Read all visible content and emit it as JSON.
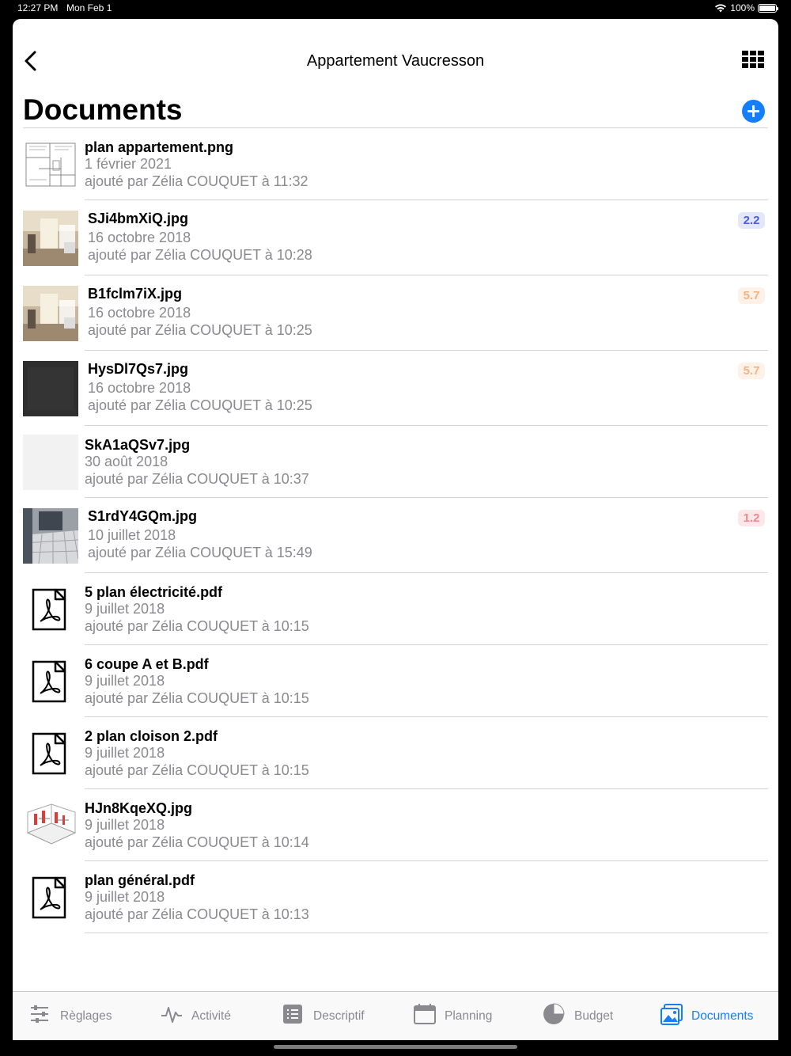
{
  "status": {
    "time": "12:27 PM",
    "date": "Mon Feb 1",
    "battery": "100%"
  },
  "nav": {
    "title": "Appartement Vaucresson"
  },
  "page": {
    "title": "Documents"
  },
  "colors": {
    "accent": "#147efb",
    "badge_blue": "#4a5fe0",
    "badge_orange": "#f2b385",
    "badge_red": "#f4868e"
  },
  "documents": [
    {
      "name": "plan appartement.png",
      "date": "1 février 2021",
      "added_by": "ajouté par Zélia COUQUET à 11:32",
      "thumb": "floorplan"
    },
    {
      "name": "SJi4bmXiQ.jpg",
      "date": "16 octobre 2018",
      "added_by": "ajouté par Zélia COUQUET à 10:28",
      "thumb": "room-photo",
      "badge": "2.2"
    },
    {
      "name": "B1fclm7iX.jpg",
      "date": "16 octobre 2018",
      "added_by": "ajouté par Zélia COUQUET à 10:25",
      "thumb": "room-photo",
      "badge": "5.7"
    },
    {
      "name": "HysDl7Qs7.jpg",
      "date": "16 octobre 2018",
      "added_by": "ajouté par Zélia COUQUET à 10:25",
      "thumb": "dark-photo",
      "badge": "5.7"
    },
    {
      "name": "SkA1aQSv7.jpg",
      "date": "30 août 2018",
      "added_by": "ajouté par Zélia COUQUET à 10:37",
      "thumb": "blank"
    },
    {
      "name": "S1rdY4GQm.jpg",
      "date": "10 juillet 2018",
      "added_by": "ajouté par Zélia COUQUET à 15:49",
      "thumb": "tile-photo",
      "badge": "1.2"
    },
    {
      "name": "5 plan électricité.pdf",
      "date": "9 juillet 2018",
      "added_by": "ajouté par Zélia COUQUET à 10:15",
      "thumb": "pdf"
    },
    {
      "name": "6 coupe A et B.pdf",
      "date": "9 juillet 2018",
      "added_by": "ajouté par Zélia COUQUET à 10:15",
      "thumb": "pdf"
    },
    {
      "name": "2 plan cloison 2.pdf",
      "date": "9 juillet 2018",
      "added_by": "ajouté par Zélia COUQUET à 10:15",
      "thumb": "pdf"
    },
    {
      "name": "HJn8KqeXQ.jpg",
      "date": "9 juillet 2018",
      "added_by": "ajouté par Zélia COUQUET à 10:14",
      "thumb": "3d-render"
    },
    {
      "name": "plan général.pdf",
      "date": "9 juillet 2018",
      "added_by": "ajouté par Zélia COUQUET à 10:13",
      "thumb": "pdf"
    }
  ],
  "tabs": [
    {
      "label": "Règlages",
      "icon": "sliders-icon"
    },
    {
      "label": "Activité",
      "icon": "activity-icon"
    },
    {
      "label": "Descriptif",
      "icon": "list-icon"
    },
    {
      "label": "Planning",
      "icon": "calendar-icon"
    },
    {
      "label": "Budget",
      "icon": "pie-chart-icon"
    },
    {
      "label": "Documents",
      "icon": "photos-icon",
      "active": true
    }
  ]
}
